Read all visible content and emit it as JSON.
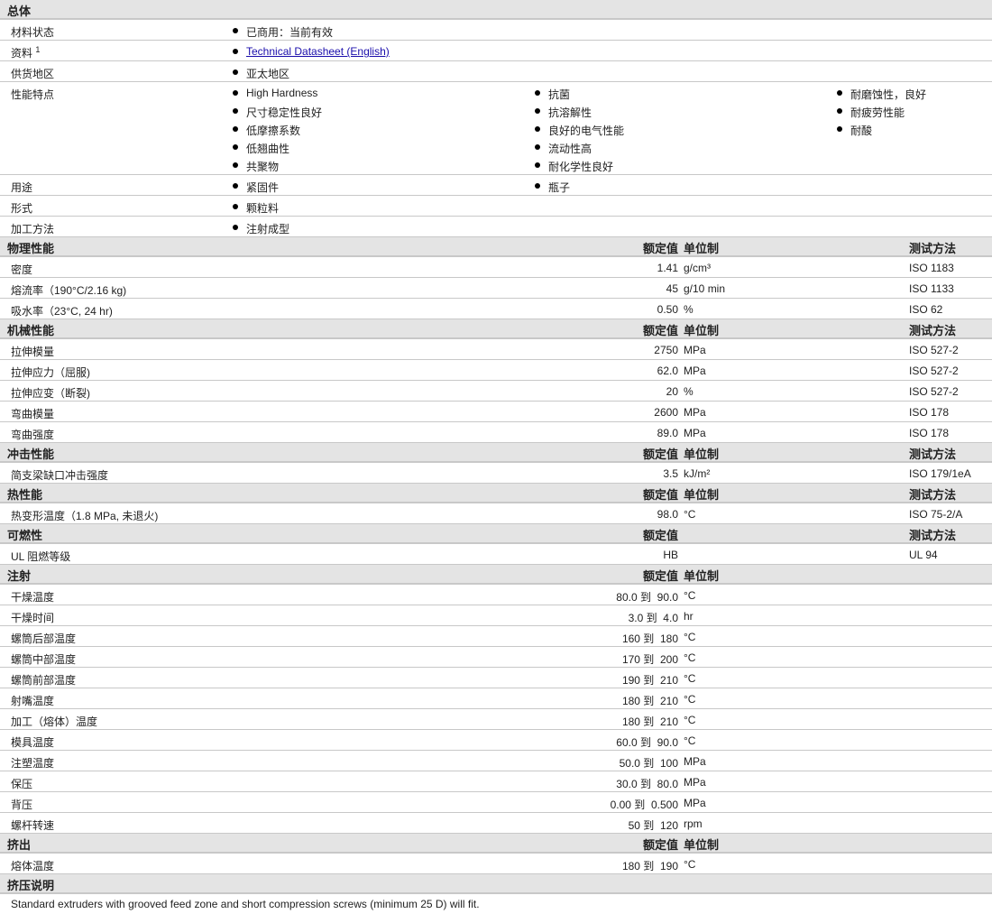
{
  "general": {
    "title": "总体",
    "rows": [
      {
        "label": "材料状态",
        "cols": [
          [
            "已商用：当前有效"
          ]
        ]
      },
      {
        "label": "资料",
        "sup": "1",
        "link": "Technical Datasheet (English)"
      },
      {
        "label": "供货地区",
        "cols": [
          [
            "亚太地区"
          ]
        ]
      },
      {
        "label": "性能特点",
        "cols": [
          [
            "High Hardness",
            "尺寸稳定性良好",
            "低摩擦系数",
            "低翘曲性",
            "共聚物"
          ],
          [
            "抗菌",
            "抗溶解性",
            "良好的电气性能",
            "流动性高",
            "耐化学性良好"
          ],
          [
            "耐磨蚀性，良好",
            "耐疲劳性能",
            "耐酸"
          ]
        ]
      },
      {
        "label": "用途",
        "cols": [
          [
            "紧固件"
          ],
          [
            "瓶子"
          ]
        ]
      },
      {
        "label": "形式",
        "cols": [
          [
            "颗粒料"
          ]
        ]
      },
      {
        "label": "加工方法",
        "cols": [
          [
            "注射成型"
          ]
        ]
      }
    ]
  },
  "sections": [
    {
      "title": "物理性能",
      "h_rating": "额定值",
      "h_unit": "单位制",
      "h_test": "测试方法",
      "rows": [
        {
          "label": "密度",
          "rating": "1.41",
          "unit": "g/cm³",
          "test": "ISO 1183"
        },
        {
          "label": "熔流率（190°C/2.16 kg)",
          "rating": "45",
          "unit": "g/10 min",
          "test": "ISO 1133"
        },
        {
          "label": "吸水率（23°C, 24 hr)",
          "rating": "0.50",
          "unit": "%",
          "test": "ISO 62"
        }
      ]
    },
    {
      "title": "机械性能",
      "h_rating": "额定值",
      "h_unit": "单位制",
      "h_test": "测试方法",
      "rows": [
        {
          "label": "拉伸模量",
          "rating": "2750",
          "unit": "MPa",
          "test": "ISO 527-2"
        },
        {
          "label": "拉伸应力（屈服)",
          "rating": "62.0",
          "unit": "MPa",
          "test": "ISO 527-2"
        },
        {
          "label": "拉伸应变（断裂)",
          "rating": "20",
          "unit": "%",
          "test": "ISO 527-2"
        },
        {
          "label": "弯曲模量",
          "rating": "2600",
          "unit": "MPa",
          "test": "ISO 178"
        },
        {
          "label": "弯曲强度",
          "rating": "89.0",
          "unit": "MPa",
          "test": "ISO 178"
        }
      ]
    },
    {
      "title": "冲击性能",
      "h_rating": "额定值",
      "h_unit": "单位制",
      "h_test": "测试方法",
      "rows": [
        {
          "label": "简支梁缺口冲击强度",
          "rating": "3.5",
          "unit": "kJ/m²",
          "test": "ISO 179/1eA"
        }
      ]
    },
    {
      "title": "热性能",
      "h_rating": "额定值",
      "h_unit": "单位制",
      "h_test": "测试方法",
      "rows": [
        {
          "label": "热变形温度（1.8 MPa, 未退火)",
          "rating": "98.0",
          "unit": "°C",
          "test": "ISO 75-2/A"
        }
      ]
    },
    {
      "title": "可燃性",
      "h_rating": "额定值",
      "h_test": "测试方法",
      "rows": [
        {
          "label": "UL 阻燃等级",
          "rating": "HB",
          "test": "UL 94"
        }
      ]
    },
    {
      "title": "注射",
      "h_rating": "额定值",
      "h_unit": "单位制",
      "rows": [
        {
          "label": "干燥温度",
          "rating": "80.0 到  90.0",
          "unit": "°C"
        },
        {
          "label": "干燥时间",
          "rating": "3.0 到  4.0",
          "unit": "hr"
        },
        {
          "label": "螺筒后部温度",
          "rating": "160 到  180",
          "unit": "°C"
        },
        {
          "label": "螺筒中部温度",
          "rating": "170 到  200",
          "unit": "°C"
        },
        {
          "label": "螺筒前部温度",
          "rating": "190 到  210",
          "unit": "°C"
        },
        {
          "label": "射嘴温度",
          "rating": "180 到  210",
          "unit": "°C"
        },
        {
          "label": "加工（熔体）温度",
          "rating": "180 到  210",
          "unit": "°C"
        },
        {
          "label": "模具温度",
          "rating": "60.0 到  90.0",
          "unit": "°C"
        },
        {
          "label": "注塑温度",
          "rating": "50.0 到  100",
          "unit": "MPa"
        },
        {
          "label": "保压",
          "rating": "30.0 到  80.0",
          "unit": "MPa"
        },
        {
          "label": "背压",
          "rating": "0.00 到  0.500",
          "unit": "MPa"
        },
        {
          "label": "螺杆转速",
          "rating": "50 到  120",
          "unit": "rpm"
        }
      ]
    },
    {
      "title": "挤出",
      "h_rating": "额定值",
      "h_unit": "单位制",
      "rows": [
        {
          "label": "熔体温度",
          "rating": "180 到  190",
          "unit": "°C"
        }
      ]
    }
  ],
  "notes": {
    "title": "挤压说明",
    "text": "Standard extruders with grooved feed zone and short compression screws (minimum 25 D) will fit."
  }
}
